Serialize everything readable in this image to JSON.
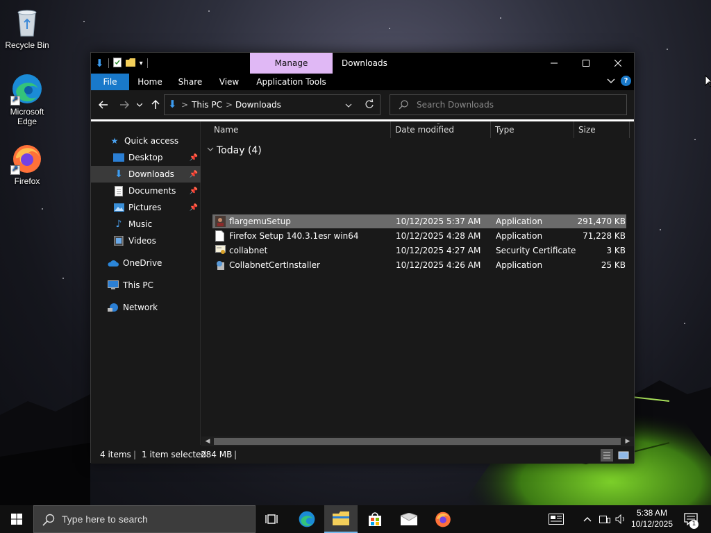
{
  "desktop": {
    "icons": [
      {
        "label": "Recycle Bin"
      },
      {
        "label": "Microsoft Edge"
      },
      {
        "label": "Firefox"
      }
    ]
  },
  "window": {
    "title": "Downloads",
    "contextual_tab": "Manage",
    "ribbon_tabs": [
      "File",
      "Home",
      "Share",
      "View",
      "Application Tools"
    ],
    "controls": {
      "minimize": "—",
      "maximize": "☐",
      "close": "✕"
    },
    "help_label": "?"
  },
  "address": {
    "crumbs": [
      "This PC",
      "Downloads"
    ],
    "separator": ">"
  },
  "search": {
    "placeholder": "Search Downloads"
  },
  "navpane": {
    "quick_access": "Quick access",
    "items": [
      {
        "label": "Desktop",
        "pinned": true
      },
      {
        "label": "Downloads",
        "pinned": true,
        "selected": true
      },
      {
        "label": "Documents",
        "pinned": true
      },
      {
        "label": "Pictures",
        "pinned": true
      },
      {
        "label": "Music",
        "pinned": false
      },
      {
        "label": "Videos",
        "pinned": false
      }
    ],
    "onedrive": "OneDrive",
    "thispc": "This PC",
    "network": "Network"
  },
  "columns": {
    "name": "Name",
    "date": "Date modified",
    "type": "Type",
    "size": "Size"
  },
  "group": {
    "label": "Today (4)"
  },
  "files": [
    {
      "name": "flargemuSetup",
      "date": "10/12/2025 5:37 AM",
      "type": "Application",
      "size": "291,470 KB",
      "selected": true
    },
    {
      "name": "Firefox Setup 140.3.1esr win64",
      "date": "10/12/2025 4:28 AM",
      "type": "Application",
      "size": "71,228 KB",
      "selected": false
    },
    {
      "name": "collabnet",
      "date": "10/12/2025 4:27 AM",
      "type": "Security Certificate",
      "size": "3 KB",
      "selected": false
    },
    {
      "name": "CollabnetCertInstaller",
      "date": "10/12/2025 4:26 AM",
      "type": "Application",
      "size": "25 KB",
      "selected": false
    }
  ],
  "status": {
    "items": "4 items",
    "selected": "1 item selected",
    "size": "284 MB"
  },
  "taskbar": {
    "search_placeholder": "Type here to search",
    "time": "5:38 AM",
    "date": "10/12/2025",
    "notification_count": "1"
  },
  "colors": {
    "accent": "#1979ca",
    "manage_tab": "#e0b8f5",
    "selected_row": "#6b6b6b"
  }
}
